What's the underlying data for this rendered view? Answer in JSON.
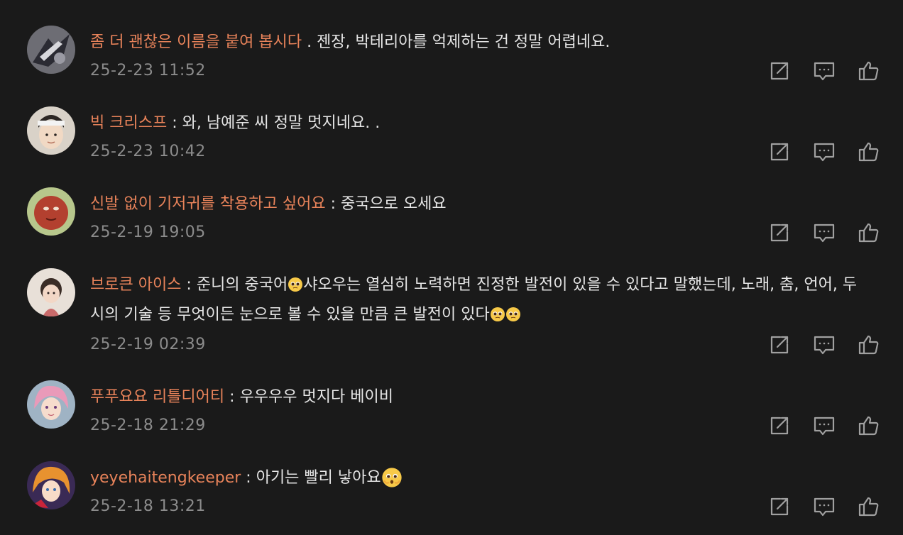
{
  "comments": [
    {
      "username": "좀 더 괜찮은 이름을 붙여 봅시다",
      "separator": " . ",
      "text": "젠장, 박테리아를 억제하는 건 정말 어렵네요.",
      "text2": "",
      "text3": "",
      "time": "25-2-23 11:52",
      "avatar": "avatar-dark-bird"
    },
    {
      "username": "빅 크리스프",
      "separator": " : ",
      "text": "와, 남예준 씨 정말 멋지네요. .",
      "text2": "",
      "text3": "",
      "time": "25-2-23 10:42",
      "avatar": "avatar-cartoon-man"
    },
    {
      "username": "신발 없이 기저귀를 착용하고 싶어요",
      "separator": " : ",
      "text": "중국으로 오세요",
      "text2": "",
      "text3": "",
      "time": "25-2-19 19:05",
      "avatar": "avatar-apple-face"
    },
    {
      "username": "브로큰 아이스",
      "separator": " : ",
      "text": "준니의 중국어",
      "text2": "샤오우는 열심히 노력하면 진정한 발전이 있을 수 있다고 말했는데, 노래, 춤, 언어, 두시의 기술 등 무엇이든 눈으로 볼 수 있을 만큼 큰 발전이 있다",
      "text3": "",
      "time": "25-2-19 02:39",
      "avatar": "avatar-child"
    },
    {
      "username": "푸푸요요 리틀디어티",
      "separator": " : ",
      "text": "우우우우 멋지다 베이비",
      "text2": "",
      "text3": "",
      "time": "25-2-18 21:29",
      "avatar": "avatar-pink-hair"
    },
    {
      "username": "yeyehaitengkeeper",
      "separator": " : ",
      "text": "아기는 빨리 낳아요",
      "text2": "",
      "text3": "",
      "time": "25-2-18 13:21",
      "avatar": "avatar-anime-orange"
    }
  ],
  "icons": {
    "share": "share-icon",
    "reply": "reply-icon",
    "like": "thumbs-up-icon",
    "emoji_pleading": "pleading-face-emoji",
    "emoji_hushed": "hushed-face-emoji"
  },
  "colors": {
    "background": "#1a1a1a",
    "username": "#e8835a",
    "text": "#e6e6e6",
    "timestamp": "#8c8c8c",
    "icon": "#a0a0a0"
  }
}
